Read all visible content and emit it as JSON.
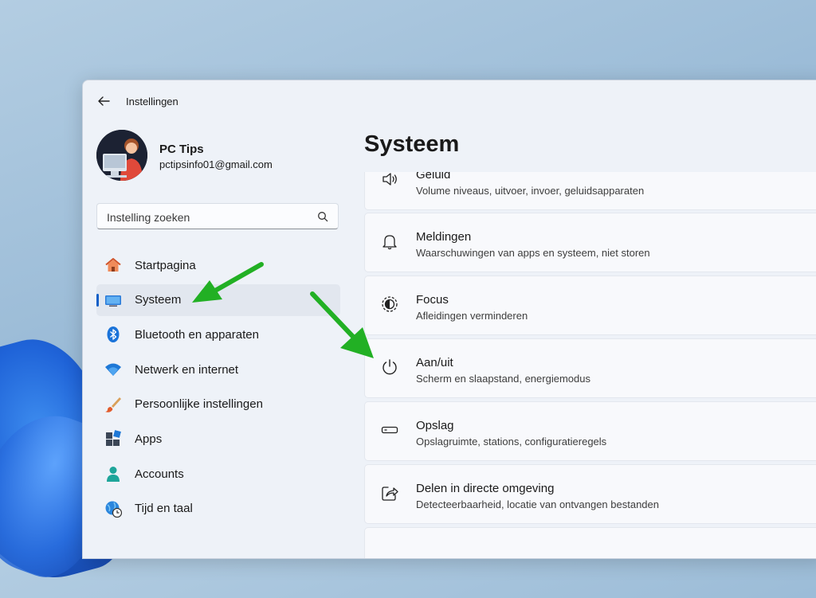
{
  "window": {
    "title": "Instellingen"
  },
  "user": {
    "name": "PC Tips",
    "email": "pctipsinfo01@gmail.com"
  },
  "search": {
    "placeholder": "Instelling zoeken"
  },
  "nav": {
    "items": [
      {
        "label": "Startpagina",
        "icon": "home-icon"
      },
      {
        "label": "Systeem",
        "icon": "monitor-icon",
        "selected": true
      },
      {
        "label": "Bluetooth en apparaten",
        "icon": "bluetooth-icon"
      },
      {
        "label": "Netwerk en internet",
        "icon": "wifi-icon"
      },
      {
        "label": "Persoonlijke instellingen",
        "icon": "brush-icon"
      },
      {
        "label": "Apps",
        "icon": "apps-icon"
      },
      {
        "label": "Accounts",
        "icon": "person-icon"
      },
      {
        "label": "Tijd en taal",
        "icon": "globe-clock-icon"
      }
    ]
  },
  "main": {
    "title": "Systeem",
    "cards": [
      {
        "title": "Geluid",
        "subtitle": "Volume niveaus, uitvoer, invoer, geluidsapparaten",
        "icon": "speaker-icon"
      },
      {
        "title": "Meldingen",
        "subtitle": "Waarschuwingen van apps en systeem, niet storen",
        "icon": "bell-icon"
      },
      {
        "title": "Focus",
        "subtitle": "Afleidingen verminderen",
        "icon": "focus-icon"
      },
      {
        "title": "Aan/uit",
        "subtitle": "Scherm en slaapstand, energiemodus",
        "icon": "power-icon"
      },
      {
        "title": "Opslag",
        "subtitle": "Opslagruimte, stations, configuratieregels",
        "icon": "storage-icon"
      },
      {
        "title": "Delen in directe omgeving",
        "subtitle": "Detecteerbaarheid, locatie van ontvangen bestanden",
        "icon": "share-icon"
      }
    ]
  },
  "colors": {
    "accent": "#0f5fc7",
    "annotation_arrow": "#22b024"
  }
}
